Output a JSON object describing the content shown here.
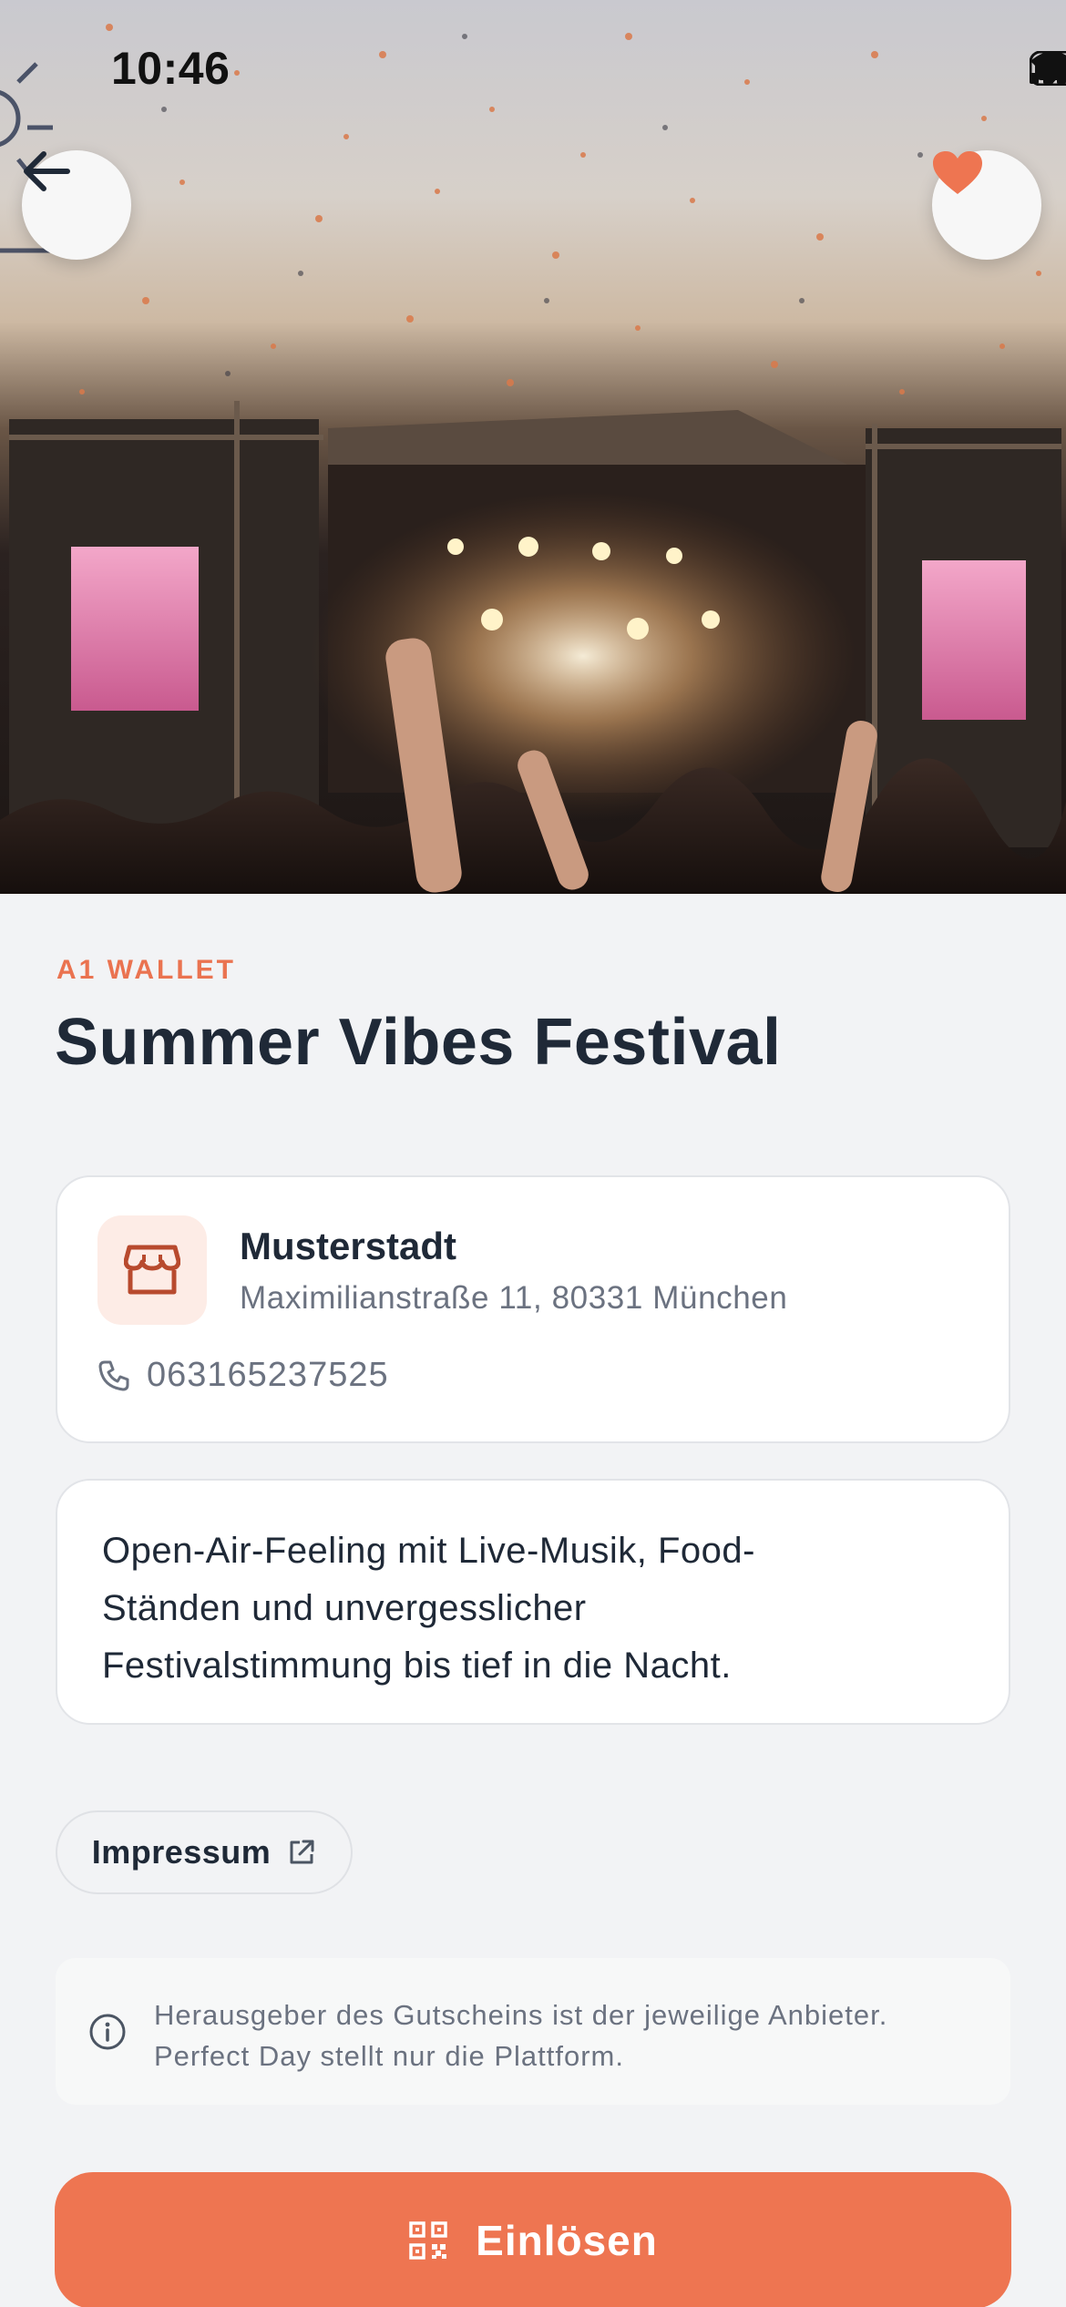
{
  "status_bar": {
    "time": "10:46"
  },
  "hero": {
    "image": "festival-stage-confetti-crowd"
  },
  "nav": {
    "back_icon": "arrow-left-icon",
    "favorite_icon": "heart-icon"
  },
  "brand": "A1 WALLET",
  "title": "Summer Vibes Festival",
  "location": {
    "name": "Musterstadt",
    "address": "Maximilianstraße 11, 80331 München",
    "phone": "063165237525",
    "icon": "store-icon"
  },
  "description": {
    "lines": [
      "Open-Air-Feeling mit Live-Musik, Food-",
      "Ständen und unvergesslicher",
      "Festivalstimmung bis tief in die Nacht."
    ]
  },
  "impressum": {
    "label": "Impressum"
  },
  "notice": {
    "lines": [
      "Herausgeber des Gutscheins ist der jeweilige Anbieter.",
      "Perfect Day stellt nur die Plattform."
    ]
  },
  "redeem": {
    "label": "Einlösen"
  },
  "colors": {
    "accent": "#ee7551",
    "brand_text": "#ea7350",
    "background": "#f2f3f5"
  }
}
